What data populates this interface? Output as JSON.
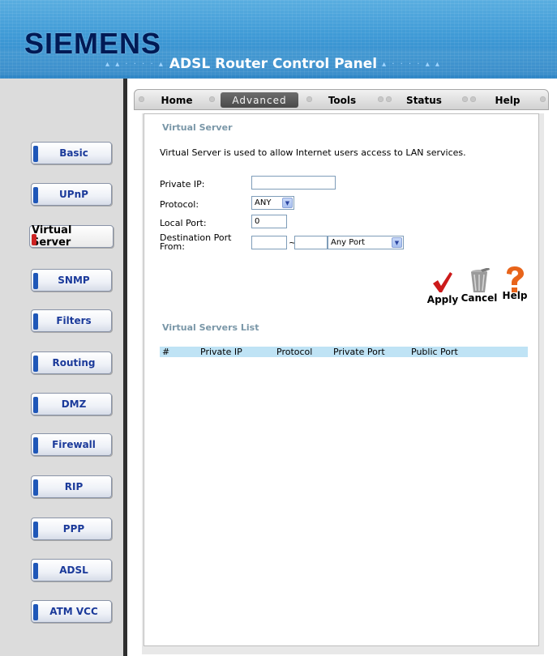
{
  "header": {
    "brand": "SIEMENS",
    "panel_title": "ADSL Router Control Panel"
  },
  "topnav": {
    "items": [
      {
        "label": "Home"
      },
      {
        "label": "Advanced"
      },
      {
        "label": "Tools"
      },
      {
        "label": "Status"
      },
      {
        "label": "Help"
      }
    ],
    "active": "Advanced"
  },
  "sidebar": {
    "items": [
      {
        "label": "Basic"
      },
      {
        "label": "UPnP"
      },
      {
        "label": "Virtual Server"
      },
      {
        "label": "SNMP"
      },
      {
        "label": "Filters"
      },
      {
        "label": "Routing"
      },
      {
        "label": "DMZ"
      },
      {
        "label": "Firewall"
      },
      {
        "label": "RIP"
      },
      {
        "label": "PPP"
      },
      {
        "label": "ADSL"
      },
      {
        "label": "ATM VCC"
      }
    ],
    "active": "Virtual Server"
  },
  "main": {
    "section_title": "Virtual Server",
    "description": "Virtual Server is used to allow Internet users access to LAN services.",
    "form": {
      "private_ip_label": "Private IP:",
      "private_ip_value": "",
      "protocol_label": "Protocol:",
      "protocol_value": "ANY",
      "local_port_label": "Local Port:",
      "local_port_value": "0",
      "dest_port_label_1": "Destination Port",
      "dest_port_label_2": "From:",
      "dest_from_value": "",
      "dest_separator": "~",
      "dest_to_value": "",
      "dest_port_select": "Any Port"
    },
    "actions": {
      "apply": "Apply",
      "cancel": "Cancel",
      "help": "Help"
    },
    "list_title": "Virtual Servers List",
    "list_columns": [
      "#",
      "Private IP",
      "Protocol",
      "Private Port",
      "Public Port"
    ]
  },
  "colors": {
    "header_blue": "#3f9ad6",
    "brand_navy": "#001a55",
    "section_title": "#7a97a8",
    "list_header_bg": "#bfe3f5",
    "apply_check": "#cc1a1a",
    "help_mark": "#e8641a"
  }
}
